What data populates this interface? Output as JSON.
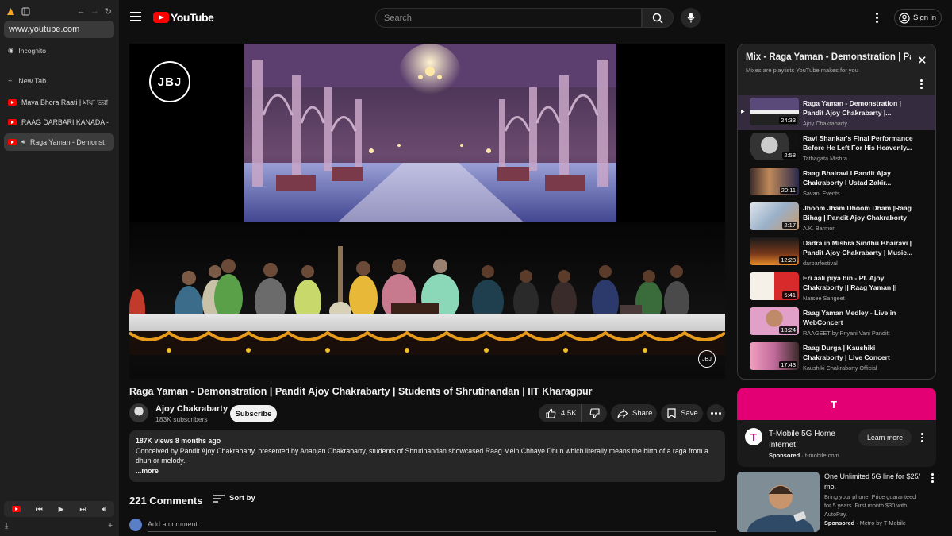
{
  "browser": {
    "url": "www.youtube.com",
    "incognito_label": "Incognito",
    "new_tab_label": "New Tab",
    "tabs": [
      {
        "label": "Maya Bhora Raati | মায়া ভরা"
      },
      {
        "label": "RAAG DARBARI KANADA -"
      },
      {
        "label": "Raga Yaman - Demonst"
      }
    ]
  },
  "header": {
    "logo_text": "YouTube",
    "search_placeholder": "Search",
    "sign_in_label": "Sign in"
  },
  "video": {
    "channel_logo_text": "JBJ",
    "title": "Raga Yaman - Demonstration | Pandit Ajoy Chakrabarty | Students of Shrutinandan | IIT Kharagpur",
    "channel_name": "Ajoy Chakrabarty",
    "subscribers": "183K subscribers",
    "subscribe_label": "Subscribe",
    "likes": "4.5K",
    "share_label": "Share",
    "save_label": "Save"
  },
  "description": {
    "meta": "187K views  8 months ago",
    "text": "Conceived by Pandit Ajoy Chakrabarty, presented by Ananjan Chakrabarty, students of Shrutinandan showcased Raag Mein Chhaye Dhun which literally means the birth of a raga from a dhun or melody.",
    "more_label": "...more"
  },
  "comments": {
    "count_label": "221 Comments",
    "sort_label": "Sort by",
    "add_placeholder": "Add a comment..."
  },
  "playlist": {
    "title": "Mix - Raga Yaman - Demonstration | Pandit Ajoy Chakrabarty | Students of Shrutinandan",
    "subtitle": "Mixes are playlists YouTube makes for you",
    "items": [
      {
        "title": "Raga Yaman - Demonstration | Pandit Ajoy Chakrabarty |...",
        "channel": "Ajoy Chakrabarty",
        "duration": "24:33",
        "current": true
      },
      {
        "title": "Ravi Shankar's Final Performance Before He Left For His Heavenly...",
        "channel": "Tathagata Mishra",
        "duration": "2:58"
      },
      {
        "title": "Raag Bhairavi I Pandit Ajay Chakraborty I Ustad Zakir...",
        "channel": "Savani Events",
        "duration": "20:11"
      },
      {
        "title": "Jhoom Jham Dhoom Dham |Raag Bihag | Pandit Ajoy Chakraborty ...",
        "channel": "A.K. Barmon",
        "duration": "2:17"
      },
      {
        "title": "Dadra in Mishra Sindhu Bhairavi | Pandit Ajoy Chakrabarty | Music...",
        "channel": "darbarfestival",
        "duration": "12:28"
      },
      {
        "title": "Eri aali piya bin - Pt. Ajoy Chakraborty || Raag Yaman ||",
        "channel": "Narsee Sangeet",
        "duration": "5:41"
      },
      {
        "title": "Raag Yaman Medley - Live in WebConcert",
        "channel": "RAAGEET by Priyani Vani Panditt",
        "duration": "13:24"
      },
      {
        "title": "Raag Durga | Kaushiki Chakraborty | Live Concert",
        "channel": "Kaushiki Chakraborty Official",
        "duration": "17:43"
      }
    ]
  },
  "ads": {
    "ad1": {
      "title": "T-Mobile 5G Home Internet",
      "sponsored": "Sponsored",
      "domain": "t-mobile.com",
      "cta": "Learn more",
      "logo_glyph": "T"
    },
    "ad2": {
      "title": "One Unlimited 5G line for $25/ mo.",
      "body": "Bring your phone. Price guaranteed for 5 years. First month $30 with AutoPay.",
      "sponsored": "Sponsored",
      "advertiser": "Metro by T-Mobile"
    }
  },
  "colors": {
    "youtube_red": "#ff0000",
    "tmobile_magenta": "#e20074",
    "playlist_current_bg": "#342b3e"
  }
}
